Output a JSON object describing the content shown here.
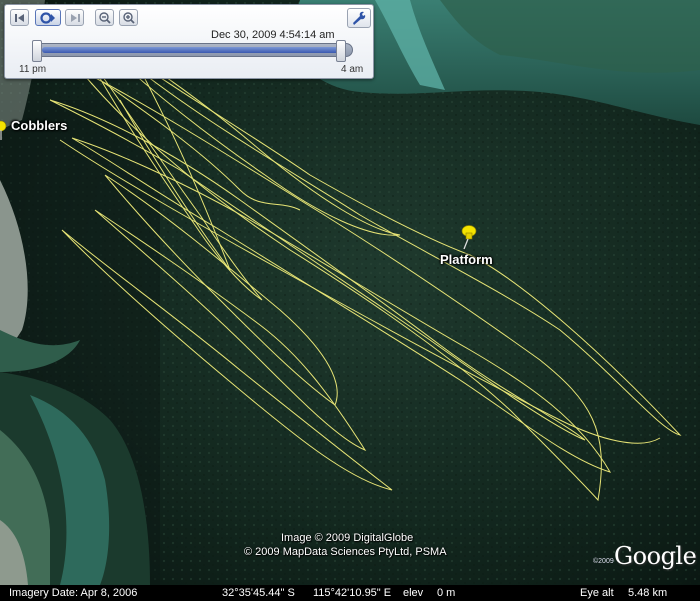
{
  "slider": {
    "current_time": "Dec 30, 2009   4:54:14 am",
    "start_label": "11 pm",
    "end_label": "4 am"
  },
  "placemarks": [
    {
      "name": "Cobblers"
    },
    {
      "name": "Platform"
    }
  ],
  "credits": {
    "line1": "Image © 2009 DigitalGlobe",
    "line2": "© 2009 MapData Sciences PtyLtd, PSMA",
    "logo": "Google",
    "logo_year": "©2009"
  },
  "status": {
    "imagery_date": "Imagery Date: Apr  8, 2006",
    "lat": "32°35'45.44\" S",
    "lon": "115°42'10.95\" E",
    "elev_label": "elev",
    "elev_value": "0 m",
    "eye_alt_label": "Eye alt",
    "eye_alt_value": "5.48 km"
  },
  "colors": {
    "track": "#f2ee7a",
    "pin": "#f5e400",
    "water": "#10231c",
    "shallow": "#3f8f82"
  },
  "icons": [
    "rewind-icon",
    "loop-icon",
    "forward-icon",
    "zoom-out-icon",
    "zoom-in-icon",
    "wrench-icon",
    "pushpin-icon"
  ]
}
